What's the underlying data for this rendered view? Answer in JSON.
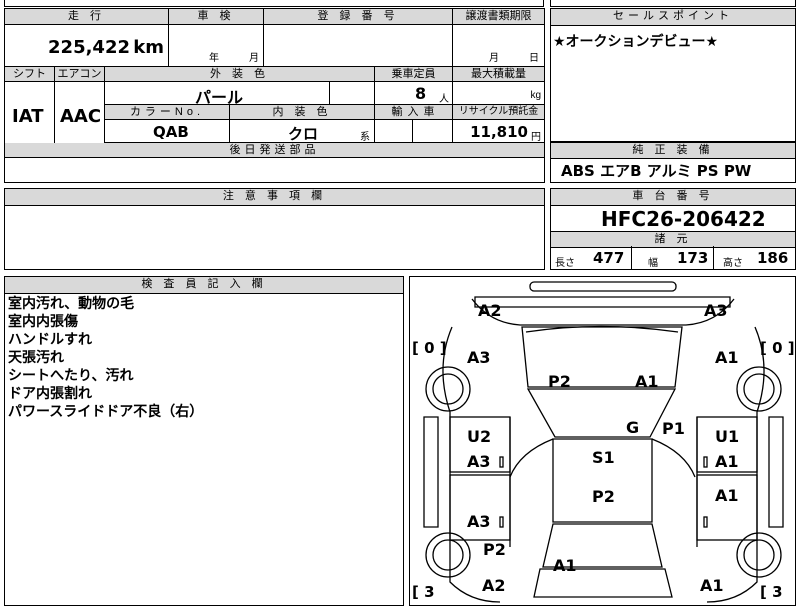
{
  "main_table": {
    "mileage_header": "走 行",
    "mileage_value": "225,422",
    "mileage_unit": "km",
    "inspection_header": "車 検",
    "inspection_year": "年",
    "inspection_month": "月",
    "registration_header": "登 録 番 号",
    "transfer_header": "譲渡書類期限",
    "transfer_month": "月",
    "transfer_day": "日",
    "shift_header": "シフト",
    "shift_value": "IAT",
    "ac_header": "エアコン",
    "ac_value": "AAC",
    "exterior_header": "外 装 色",
    "exterior_value": "パール",
    "capacity_header": "乗車定員",
    "capacity_value": "8",
    "capacity_unit": "人",
    "max_load_header": "最大積載量",
    "max_load_unit": "kg",
    "color_no_header": "カラーNo.",
    "color_no_value": "QAB",
    "interior_header": "内 装 色",
    "interior_value": "クロ",
    "interior_suffix": "系",
    "import_header": "輸 入 車",
    "recycle_header": "リサイクル預託金",
    "recycle_value": "11,810",
    "recycle_unit": "円",
    "parts_header": "後日発送部品"
  },
  "sales_point": {
    "header": "セールスポイント",
    "text": "★オークションデビュー★"
  },
  "standard_equipment": {
    "header": "純 正 装 備",
    "items": "ABS エアB アルミ PS PW"
  },
  "notes": {
    "header": "注 意 事 項 欄"
  },
  "chassis": {
    "header": "車 台 番 号",
    "number": "HFC26-206422"
  },
  "dimensions": {
    "header": "諸 元",
    "length_label": "長さ",
    "length_value": "477",
    "width_label": "幅",
    "width_value": "173",
    "height_label": "高さ",
    "height_value": "186"
  },
  "inspector": {
    "header": "検 査 員 記 入 欄",
    "lines": [
      "室内汚れ、動物の毛",
      "室内内張傷",
      "ハンドルすれ",
      "天張汚れ",
      "シートへたり、汚れ",
      "ドア内張割れ",
      "パワースライドドア不良（右）"
    ]
  },
  "diagram": {
    "bracket_left_top": "[ 0 ]",
    "bracket_right_top": "[ 0 ]",
    "bracket_left_bottom": "[ 3",
    "bracket_right_bottom": "[ 3",
    "labels": [
      "A2",
      "A3",
      "A3",
      "A1",
      "P2",
      "A1",
      "G",
      "P1",
      "U2",
      "A3",
      "S1",
      "U1",
      "A1",
      "P2",
      "A1",
      "A3",
      "P2",
      "A1",
      "A2",
      "A1"
    ]
  }
}
